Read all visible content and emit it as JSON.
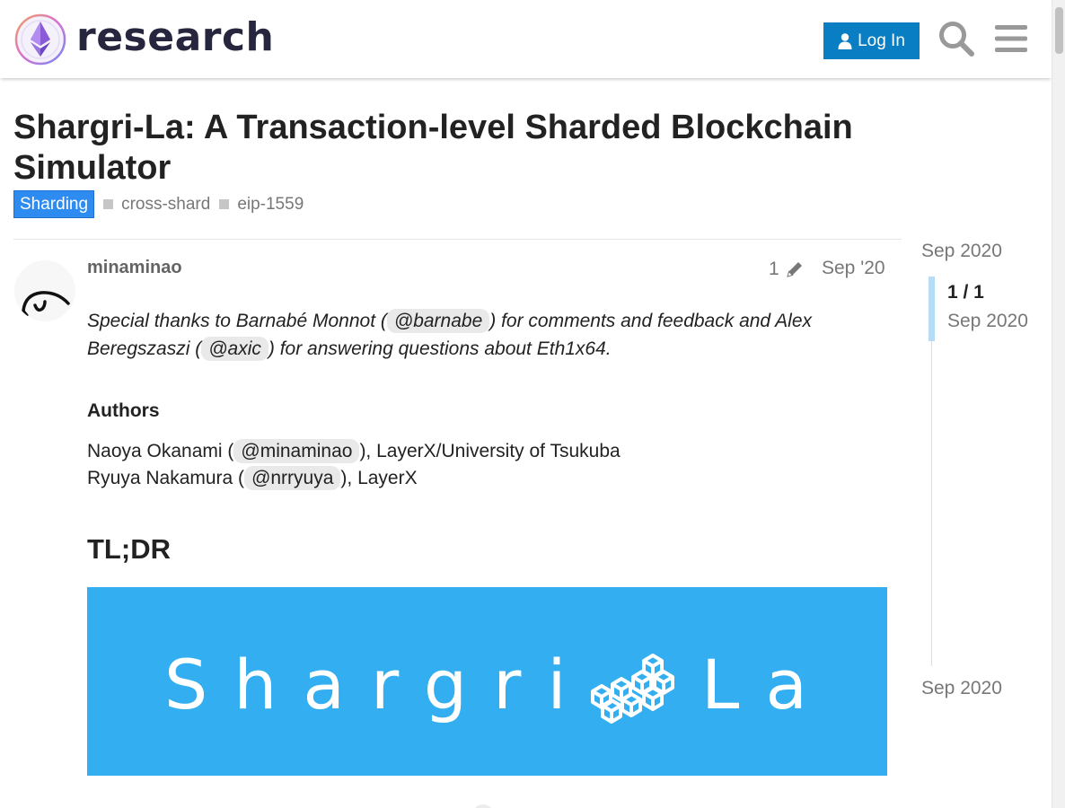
{
  "header": {
    "site_name": "research",
    "login_label": "Log In",
    "search_icon": "search-icon",
    "menu_icon": "hamburger-menu-icon",
    "accent_color": "#0a7ec2"
  },
  "topic": {
    "title": "Shargri-La: A Transaction-level Sharded Blockchain Simulator",
    "category": "Sharding",
    "category_color": "#2e8bf0",
    "tags": [
      "cross-shard",
      "eip-1559"
    ]
  },
  "post": {
    "username": "minaminao",
    "edit_count": "1",
    "date": "Sep '20",
    "intro": {
      "p1": "Special thanks to Barnabé Monnot (",
      "m1": "@barnabe",
      "p2": ") for comments and feedback and Alex Beregszaszi (",
      "m2": "@axic",
      "p3": ") for answering questions about Eth1x64."
    },
    "authors_heading": "Authors",
    "authors": [
      {
        "name": "Naoya Okanami (",
        "mention": "@minaminao",
        "affil": "), LayerX/University of Tsukuba"
      },
      {
        "name": "Ryuya Nakamura (",
        "mention": "@nrryuya",
        "affil": "), LayerX"
      }
    ],
    "tldr_heading": "TL;DR",
    "banner": {
      "text_left": "Shargri",
      "text_right": "La",
      "background": "#33aef0"
    }
  },
  "timeline": {
    "start": "Sep 2020",
    "position": "1 / 1",
    "position_date": "Sep 2020",
    "end": "Sep 2020"
  }
}
